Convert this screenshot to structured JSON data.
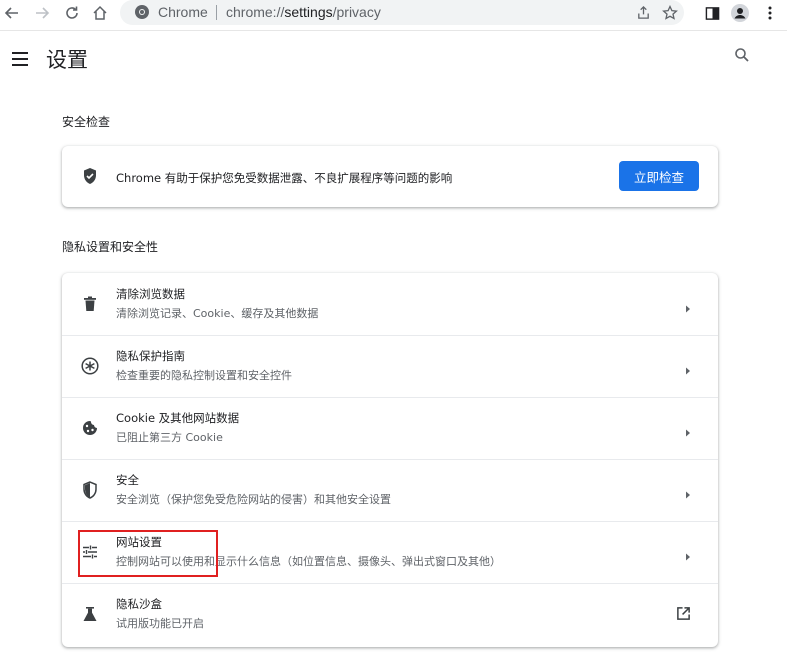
{
  "browser": {
    "omnibox_chip": "Chrome",
    "url_scheme": "chrome://",
    "url_host": "settings",
    "url_path": "/privacy",
    "nav_icons": [
      "back-icon",
      "forward-icon",
      "reload-icon",
      "home-icon"
    ],
    "right_icons": [
      "share-icon",
      "star-icon",
      "side-panel-icon",
      "profile-icon",
      "more-icon"
    ]
  },
  "header": {
    "title": "设置"
  },
  "safety_check": {
    "heading": "安全检查",
    "description": "Chrome 有助于保护您免受数据泄露、不良扩展程序等问题的影响",
    "button_label": "立即检查",
    "accent_color": "#1a73e8"
  },
  "privacy": {
    "heading": "隐私设置和安全性",
    "items": [
      {
        "title": "清除浏览数据",
        "subtitle": "清除浏览记录、Cookie、缓存及其他数据",
        "icon": "trash-icon",
        "trailing": "arrow"
      },
      {
        "title": "隐私保护指南",
        "subtitle": "检查重要的隐私控制设置和安全控件",
        "icon": "privacy-guide-icon",
        "trailing": "arrow"
      },
      {
        "title": "Cookie 及其他网站数据",
        "subtitle": "已阻止第三方 Cookie",
        "icon": "cookie-icon",
        "trailing": "arrow"
      },
      {
        "title": "安全",
        "subtitle": "安全浏览（保护您免受危险网站的侵害）和其他安全设置",
        "icon": "shield-icon",
        "trailing": "arrow"
      },
      {
        "title": "网站设置",
        "subtitle": "控制网站可以使用和显示什么信息（如位置信息、摄像头、弹出式窗口及其他）",
        "icon": "tune-icon",
        "trailing": "arrow"
      },
      {
        "title": "隐私沙盒",
        "subtitle": "试用版功能已开启",
        "icon": "flask-icon",
        "trailing": "external-link"
      }
    ]
  },
  "annotation_color": "#e02020"
}
